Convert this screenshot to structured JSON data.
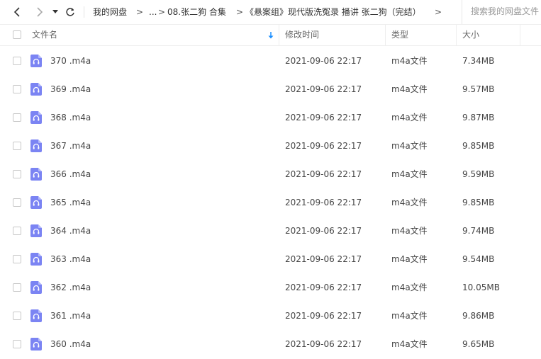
{
  "toolbar": {
    "breadcrumbs": [
      {
        "label": "我的网盘"
      },
      {
        "label": "..."
      },
      {
        "label": "08.张二狗 合集"
      },
      {
        "label": "《悬案组》现代版洗冤录  播讲 张二狗（完结）"
      }
    ],
    "separator": ">",
    "search_placeholder": "搜索我的网盘文件"
  },
  "columns": {
    "name": "文件名",
    "modified": "修改时间",
    "type": "类型",
    "size": "大小"
  },
  "files": [
    {
      "name": "370 .m4a",
      "modified": "2021-09-06 22:17",
      "type": "m4a文件",
      "size": "7.34MB"
    },
    {
      "name": "369 .m4a",
      "modified": "2021-09-06 22:17",
      "type": "m4a文件",
      "size": "9.57MB"
    },
    {
      "name": "368 .m4a",
      "modified": "2021-09-06 22:17",
      "type": "m4a文件",
      "size": "9.87MB"
    },
    {
      "name": "367 .m4a",
      "modified": "2021-09-06 22:17",
      "type": "m4a文件",
      "size": "9.85MB"
    },
    {
      "name": "366 .m4a",
      "modified": "2021-09-06 22:17",
      "type": "m4a文件",
      "size": "9.59MB"
    },
    {
      "name": "365 .m4a",
      "modified": "2021-09-06 22:17",
      "type": "m4a文件",
      "size": "9.85MB"
    },
    {
      "name": "364 .m4a",
      "modified": "2021-09-06 22:17",
      "type": "m4a文件",
      "size": "9.74MB"
    },
    {
      "name": "363 .m4a",
      "modified": "2021-09-06 22:17",
      "type": "m4a文件",
      "size": "9.54MB"
    },
    {
      "name": "362 .m4a",
      "modified": "2021-09-06 22:17",
      "type": "m4a文件",
      "size": "10.05MB"
    },
    {
      "name": "361 .m4a",
      "modified": "2021-09-06 22:17",
      "type": "m4a文件",
      "size": "9.86MB"
    },
    {
      "name": "360 .m4a",
      "modified": "2021-09-06 22:17",
      "type": "m4a文件",
      "size": "9.65MB"
    }
  ],
  "colors": {
    "file_icon": "#7b84f3",
    "sort_arrow": "#1e90ff"
  }
}
